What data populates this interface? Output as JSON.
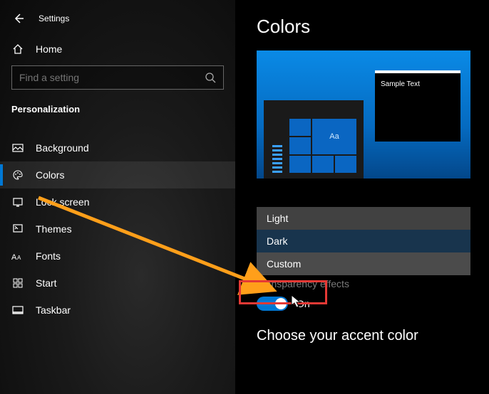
{
  "app": {
    "title": "Settings"
  },
  "sidebar": {
    "home": "Home",
    "search_placeholder": "Find a setting",
    "section": "Personalization",
    "items": [
      {
        "label": "Background"
      },
      {
        "label": "Colors"
      },
      {
        "label": "Lock screen"
      },
      {
        "label": "Themes"
      },
      {
        "label": "Fonts"
      },
      {
        "label": "Start"
      },
      {
        "label": "Taskbar"
      }
    ]
  },
  "main": {
    "title": "Colors",
    "preview": {
      "sample_text": "Sample Text",
      "tile_label": "Aa"
    },
    "mode_options": [
      "Light",
      "Dark",
      "Custom"
    ],
    "transparency": {
      "label": "Transparency effects",
      "state": "On"
    },
    "accent_heading": "Choose your accent color"
  }
}
